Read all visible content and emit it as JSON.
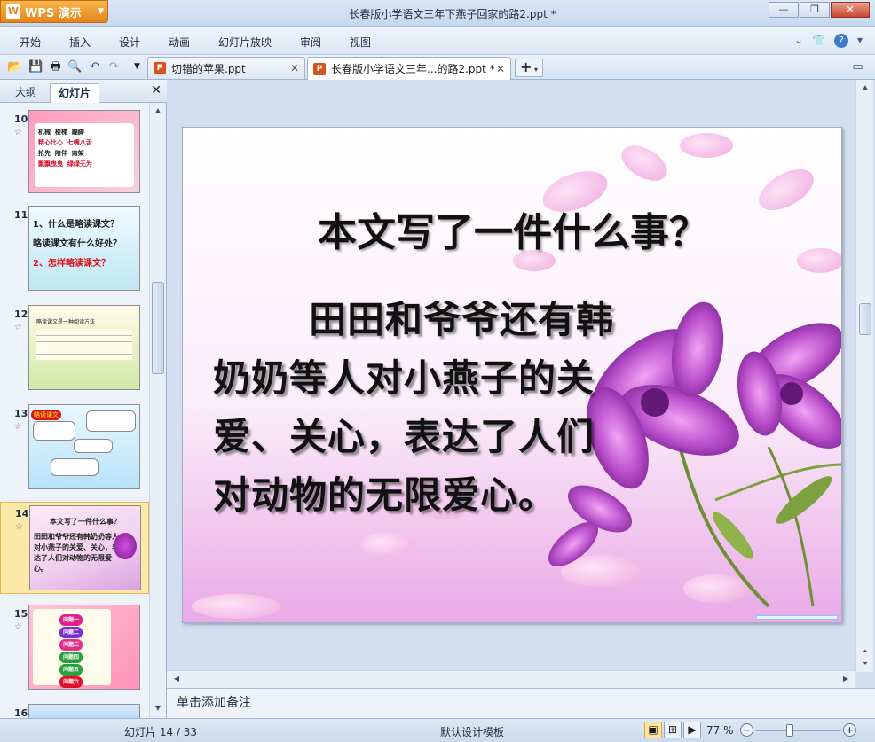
{
  "app": {
    "name": "WPS 演示",
    "window_title": "长春版小学语文三年下燕子回家的路2.ppt *"
  },
  "menu": [
    "开始",
    "插入",
    "设计",
    "动画",
    "幻灯片放映",
    "审阅",
    "视图"
  ],
  "doc_tabs": [
    {
      "label": "切错的苹果.ppt",
      "active": false
    },
    {
      "label": "长春版小学语文三年...的路2.ppt *",
      "active": true
    }
  ],
  "left_pane": {
    "tabs": [
      "大纲",
      "幻灯片"
    ],
    "active_tab": "幻灯片",
    "close_glyph": "✕",
    "thumbnails": [
      {
        "num": "10",
        "lines": [
          "机械",
          "楼梯",
          "蹦脚",
          "精心比心",
          "七嘴八舌",
          "抢先",
          "陪伴",
          "南架",
          "飘飘曳曳",
          "绿绿无为"
        ]
      },
      {
        "num": "11",
        "lines": [
          "1、什么是略读课文？",
          "略读课文有什么好处？",
          "2、怎样略读课文？"
        ]
      },
      {
        "num": "12",
        "lines": [
          "略读课文是一种阅读方法"
        ]
      },
      {
        "num": "13",
        "lines": [
          "略读课文"
        ]
      },
      {
        "num": "14",
        "lines": [
          "本文写了一件什么事？",
          "田田和爷爷还有韩奶奶等人对小燕子的关爱、关心，表达了人们对动物的无限爱心。"
        ],
        "selected": true
      },
      {
        "num": "15",
        "lines": [
          "问题一",
          "问题二",
          "问题三",
          "问题四",
          "问题五",
          "问题六"
        ]
      },
      {
        "num": "16",
        "lines": []
      }
    ]
  },
  "slide": {
    "title": "本文写了一件什么事？",
    "body_lines": [
      "田田和爷爷还有韩",
      "奶奶等人对小燕子的关",
      "爱、关心，表达了人们",
      "对动物的无限爱心。"
    ]
  },
  "notes": {
    "placeholder": "单击添加备注"
  },
  "status": {
    "slide_counter": "幻灯片 14 / 33",
    "template": "默认设计模板",
    "zoom": "77 %",
    "zoom_level": 0.77
  },
  "colors": {
    "accent": "#e5831b",
    "selection": "#fce8a8",
    "ribbon": "#dde8f5"
  }
}
